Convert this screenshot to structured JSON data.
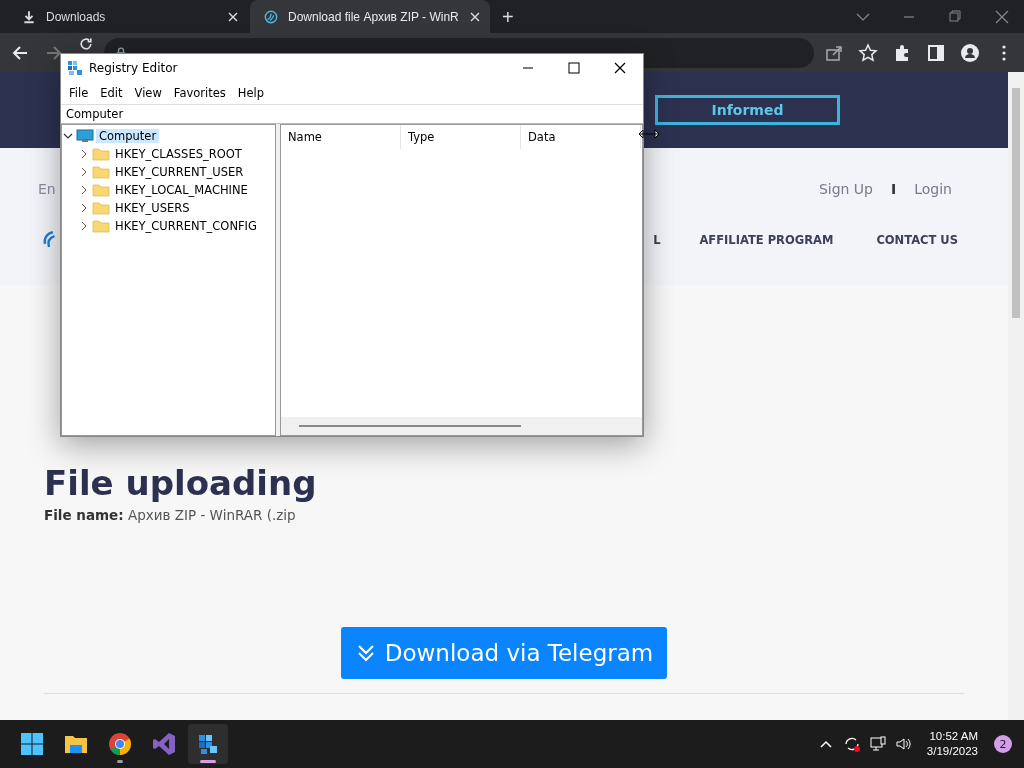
{
  "browser": {
    "tabs": [
      {
        "title": "Downloads",
        "selected": false,
        "kind": "download"
      },
      {
        "title": "Download file Архив ZIP - WinR",
        "selected": true,
        "kind": "site"
      }
    ],
    "new_tab": "+"
  },
  "page": {
    "informed_button": "Informed",
    "language": "En",
    "sign_up": "Sign Up",
    "separator": "I",
    "login": "Login",
    "nav": [
      "L",
      "AFFILIATE PROGRAM",
      "CONTACT US"
    ],
    "heading": "File uploading",
    "file_name_label": "File name:",
    "file_name": "Архив ZIP - WinRAR (.zip",
    "download_button": "Download via Telegram"
  },
  "registry_editor": {
    "title": "Registry Editor",
    "menu": [
      "File",
      "Edit",
      "View",
      "Favorites",
      "Help"
    ],
    "path": "Computer",
    "tree": [
      {
        "label": "Computer",
        "expanded": true,
        "selected": true,
        "children": [
          {
            "label": "HKEY_CLASSES_ROOT",
            "expanded": false,
            "selected": false
          },
          {
            "label": "HKEY_CURRENT_USER",
            "expanded": false,
            "selected": false
          },
          {
            "label": "HKEY_LOCAL_MACHINE",
            "expanded": false,
            "selected": false
          },
          {
            "label": "HKEY_USERS",
            "expanded": false,
            "selected": false
          },
          {
            "label": "HKEY_CURRENT_CONFIG",
            "expanded": false,
            "selected": false
          }
        ]
      }
    ],
    "columns": [
      "Name",
      "Type",
      "Data"
    ]
  },
  "taskbar": {
    "apps": [
      {
        "kind": "start",
        "running": false,
        "active": false
      },
      {
        "kind": "explorer",
        "running": false,
        "active": false
      },
      {
        "kind": "chrome",
        "running": true,
        "active": false
      },
      {
        "kind": "vs",
        "running": false,
        "active": false
      },
      {
        "kind": "regedit",
        "running": true,
        "active": true
      }
    ],
    "time": "10:52 AM",
    "date": "3/19/2023",
    "notification_count": "2"
  }
}
